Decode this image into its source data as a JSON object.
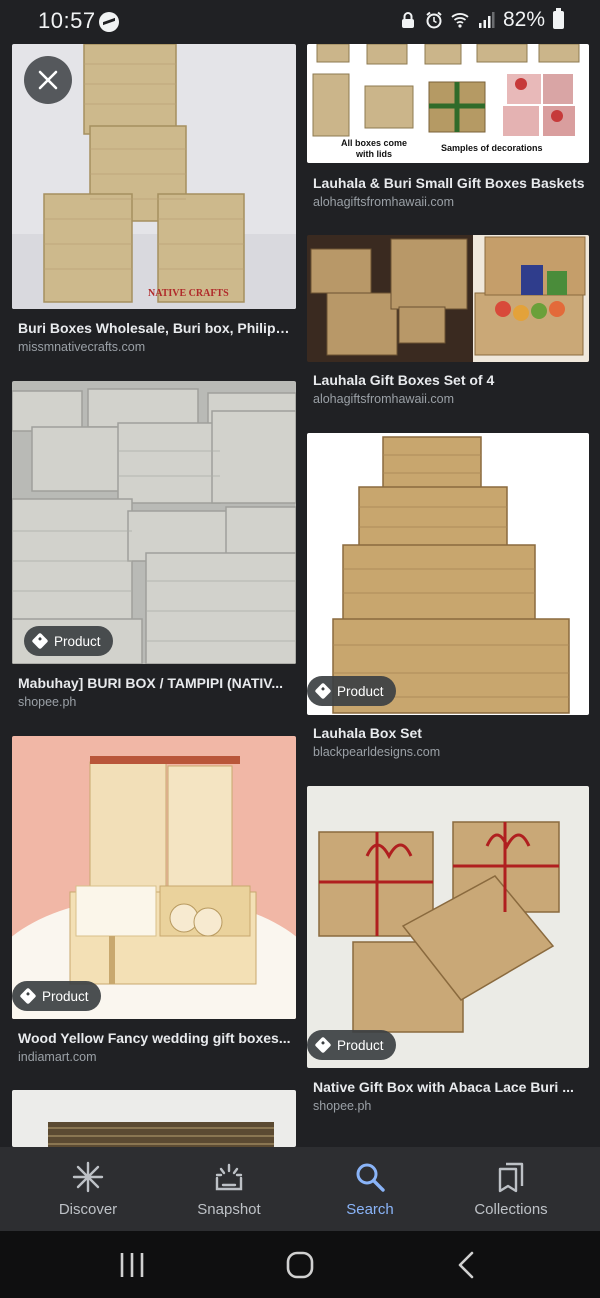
{
  "status_bar": {
    "time": "10:57",
    "battery": "82%"
  },
  "results": [
    {
      "title": "Buri Boxes Wholesale, Buri box, Philipp...",
      "domain": "missmnativecrafts.com",
      "badge": ""
    },
    {
      "title": "Lauhala & Buri Small Gift Boxes Baskets",
      "domain": "alohagiftsfromhawaii.com",
      "badge": "",
      "image_text": {
        "caption_left": "All boxes come with lids",
        "caption_right": "Samples of decorations"
      }
    },
    {
      "title": "Lauhala Gift Boxes Set of 4",
      "domain": "alohagiftsfromhawaii.com",
      "badge": ""
    },
    {
      "title": "Mabuhay] BURI BOX / TAMPIPI (NATIV...",
      "domain": "shopee.ph",
      "badge": "Product"
    },
    {
      "title": "Lauhala Box Set",
      "domain": "blackpearldesigns.com",
      "badge": "Product"
    },
    {
      "title": "Wood Yellow Fancy wedding gift boxes...",
      "domain": "indiamart.com",
      "badge": "Product"
    },
    {
      "title": "Native Gift Box with Abaca Lace Buri ...",
      "domain": "shopee.ph",
      "badge": "Product"
    }
  ],
  "bottom_nav": [
    {
      "label": "Discover",
      "icon": "asterisk-icon",
      "active": false
    },
    {
      "label": "Snapshot",
      "icon": "snapshot-icon",
      "active": false
    },
    {
      "label": "Search",
      "icon": "search-icon",
      "active": true
    },
    {
      "label": "Collections",
      "icon": "collections-icon",
      "active": false
    }
  ],
  "colors": {
    "background": "#202124",
    "accent": "#8ab4f8",
    "nav_bg": "#2d2e31"
  }
}
